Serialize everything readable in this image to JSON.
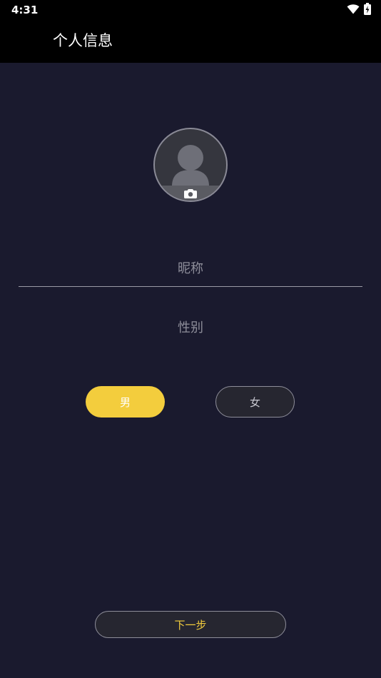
{
  "status_bar": {
    "time": "4:31",
    "icons": [
      "wifi-icon",
      "battery-charging-icon"
    ]
  },
  "header": {
    "title": "个人信息"
  },
  "avatar": {
    "icon": "person-silhouette-icon",
    "overlay_icon": "camera-icon"
  },
  "form": {
    "nickname_placeholder": "昵称",
    "nickname_value": "",
    "gender_label": "性别",
    "gender_options": [
      "男",
      "女"
    ],
    "selected_gender": "男"
  },
  "actions": {
    "next_label": "下一步"
  },
  "colors": {
    "background": "#1a1a2e",
    "header": "#000000",
    "accent": "#f3cd3d",
    "button_dark": "#262630"
  }
}
